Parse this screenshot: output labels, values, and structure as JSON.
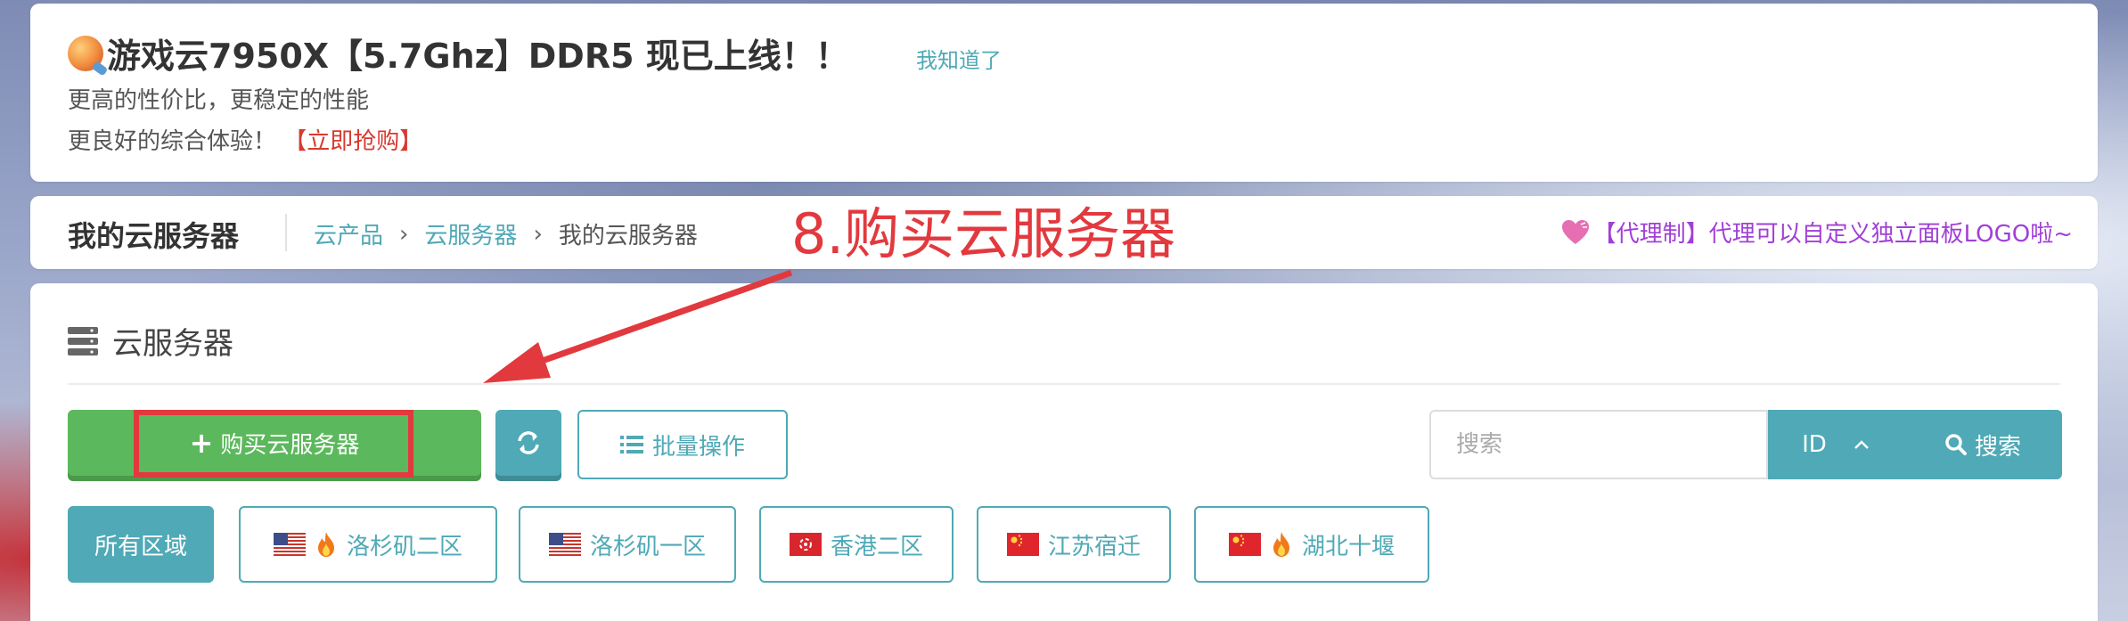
{
  "notice": {
    "title": "游戏云7950X【5.7Ghz】DDR5 现已上线！！",
    "dismiss_label": "我知道了",
    "line1": "更高的性价比，更稳定的性能",
    "line2": "更良好的综合体验！",
    "buy_link": "【立即抢购】"
  },
  "header": {
    "page_title": "我的云服务器",
    "breadcrumb": [
      "云产品",
      "云服务器",
      "我的云服务器"
    ],
    "annotation": "8.购买云服务器",
    "promo": "【代理制】代理可以自定义独立面板LOGO啦~"
  },
  "main": {
    "section_title": "云服务器",
    "buy_button": "购买云服务器",
    "batch_button": "批量操作",
    "search": {
      "placeholder": "搜索",
      "field": "ID",
      "button": "搜索"
    },
    "regions": [
      {
        "label": "所有区域",
        "active": true
      },
      {
        "label": "洛杉矶二区",
        "flag": "us-flag",
        "hot": true
      },
      {
        "label": "洛杉矶一区",
        "flag": "us-flag",
        "hot": false
      },
      {
        "label": "香港二区",
        "flag": "hk-flag",
        "hot": false
      },
      {
        "label": "江苏宿迁",
        "flag": "cn-flag",
        "hot": false
      },
      {
        "label": "湖北十堰",
        "flag": "cn-flag",
        "hot": true
      }
    ]
  },
  "colors": {
    "primary": "#4fa9b6",
    "success": "#5cb85c",
    "annotation_red": "#e2393e",
    "promo_purple": "#a13fd8"
  }
}
